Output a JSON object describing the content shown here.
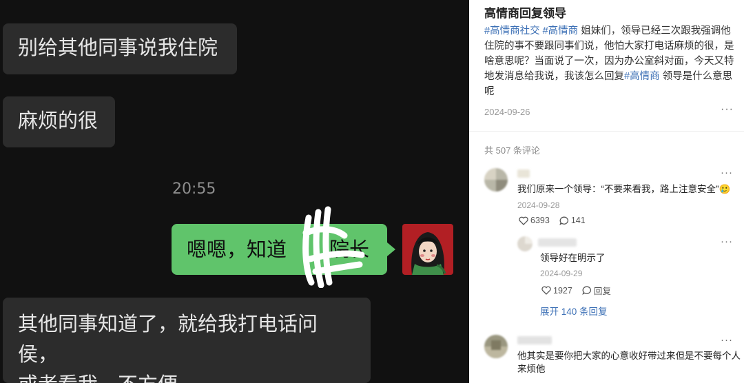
{
  "chat": {
    "msg1": "别给其他同事说我住院",
    "msg2": "麻烦的很",
    "time": "20:55",
    "reply_left": "嗯嗯，知道",
    "reply_right": "院长",
    "msg3_line1": "其他同事知道了，就给我打电话问侯，",
    "msg3_line2": "或者看我，不方便"
  },
  "post": {
    "title": "高情商回复领导",
    "tag1": "#高情商社交",
    "tag2": "#高情商",
    "body1": "姐妹们，领导已经三次跟我强调他住院的事不要跟同事们说，他怕大家打电话麻烦的很，是啥意思呢？当面说了一次，因为办公室斜对面，今天又特地发消息给我说，我该怎么回复",
    "tag3": "#高情商",
    "body2": "领导是什么意思呢",
    "date": "2024-09-26",
    "more": "···",
    "comment_count": "共 507 条评论"
  },
  "comments": [
    {
      "text": "我们原来一个领导：“不要来看我，路上注意安全”",
      "emoji": "🥲",
      "date": "2024-09-28",
      "likes": "6393",
      "replies": "141",
      "more": "···"
    },
    {
      "text": "领导好在明示了",
      "date": "2024-09-29",
      "likes": "1927",
      "reply_label": "回复",
      "more": "···"
    },
    {
      "text_line1": "他其实是要你把大家的心意收好带过来但是不要每个人",
      "text_line2": "来烦他",
      "more": "···"
    }
  ],
  "expand_replies": "展开 140 条回复",
  "colors": {
    "chat_bg": "#111111",
    "bubble_in": "#2c2c2c",
    "bubble_out": "#60c46b",
    "link": "#3b6fb5"
  }
}
